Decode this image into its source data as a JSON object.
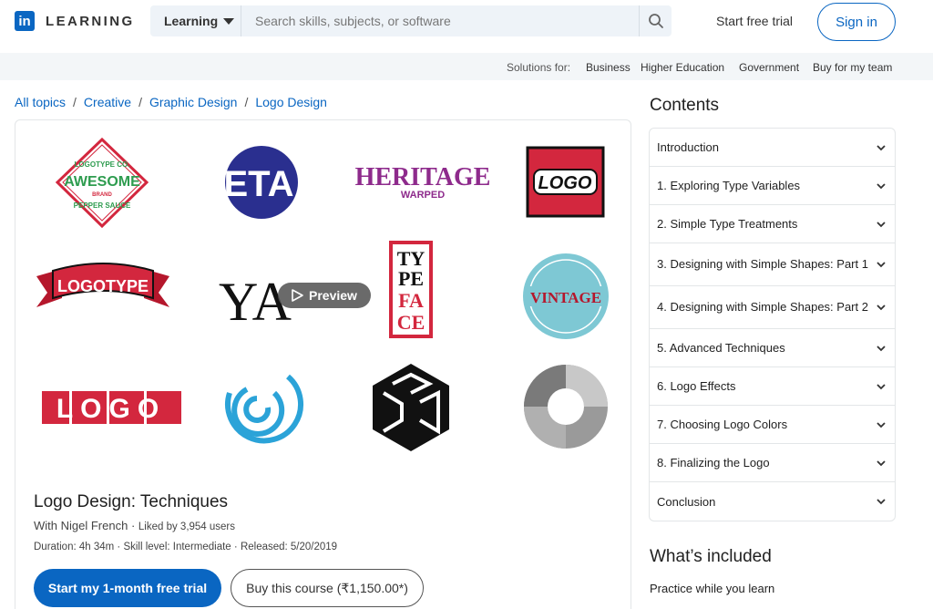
{
  "header": {
    "logo_letters": "in",
    "logo_word": "LEARNING",
    "search": {
      "dropdown_label": "Learning",
      "placeholder": "Search skills, subjects, or software"
    },
    "start_trial": "Start free trial",
    "sign_in": "Sign in"
  },
  "solutions": {
    "label": "Solutions for:",
    "links": [
      "Business",
      "Higher Education",
      "Government",
      "Buy for my team"
    ]
  },
  "breadcrumb": [
    "All topics",
    "Creative",
    "Graphic Design",
    "Logo Design"
  ],
  "course": {
    "preview_label": "Preview",
    "logo_texts": [
      "LOGOTYPE CO.",
      "AWESOME",
      "BRAND",
      "PEPPER SAUCE",
      "ETA",
      "HERITAGE",
      "WARPED",
      "LOGO",
      "LOGOTYPE",
      "YA",
      "TY",
      "PE",
      "FA",
      "CE",
      "VINTAGE",
      "LOGO"
    ],
    "title": "Logo Design: Techniques",
    "author": "With Nigel French",
    "likes": "Liked by 3,954 users",
    "duration": "Duration: 4h 34m",
    "skill": "Skill level: Intermediate",
    "released": "Released: 5/20/2019",
    "trial_button": "Start my 1-month free trial",
    "buy_button": "Buy this course (₹1,150.00*)"
  },
  "contents": {
    "title": "Contents",
    "items": [
      "Introduction",
      "1. Exploring Type Variables",
      "2. Simple Type Treatments",
      "3. Designing with Simple Shapes: Part 1",
      "4. Designing with Simple Shapes: Part 2",
      "5. Advanced Techniques",
      "6. Logo Effects",
      "7. Choosing Logo Colors",
      "8. Finalizing the Logo",
      "Conclusion"
    ]
  },
  "included": {
    "title": "What’s included",
    "practice": "Practice while you learn"
  },
  "colors": {
    "brand": "#0a66c2",
    "logo_red": "#d3273e",
    "logo_navy": "#2a2f8f",
    "heritage_purple": "#8e2b8c",
    "circle_blue": "#2ba3d8",
    "vintage_teal": "#7ec8d4",
    "awesome_green": "#2e9c4f"
  }
}
